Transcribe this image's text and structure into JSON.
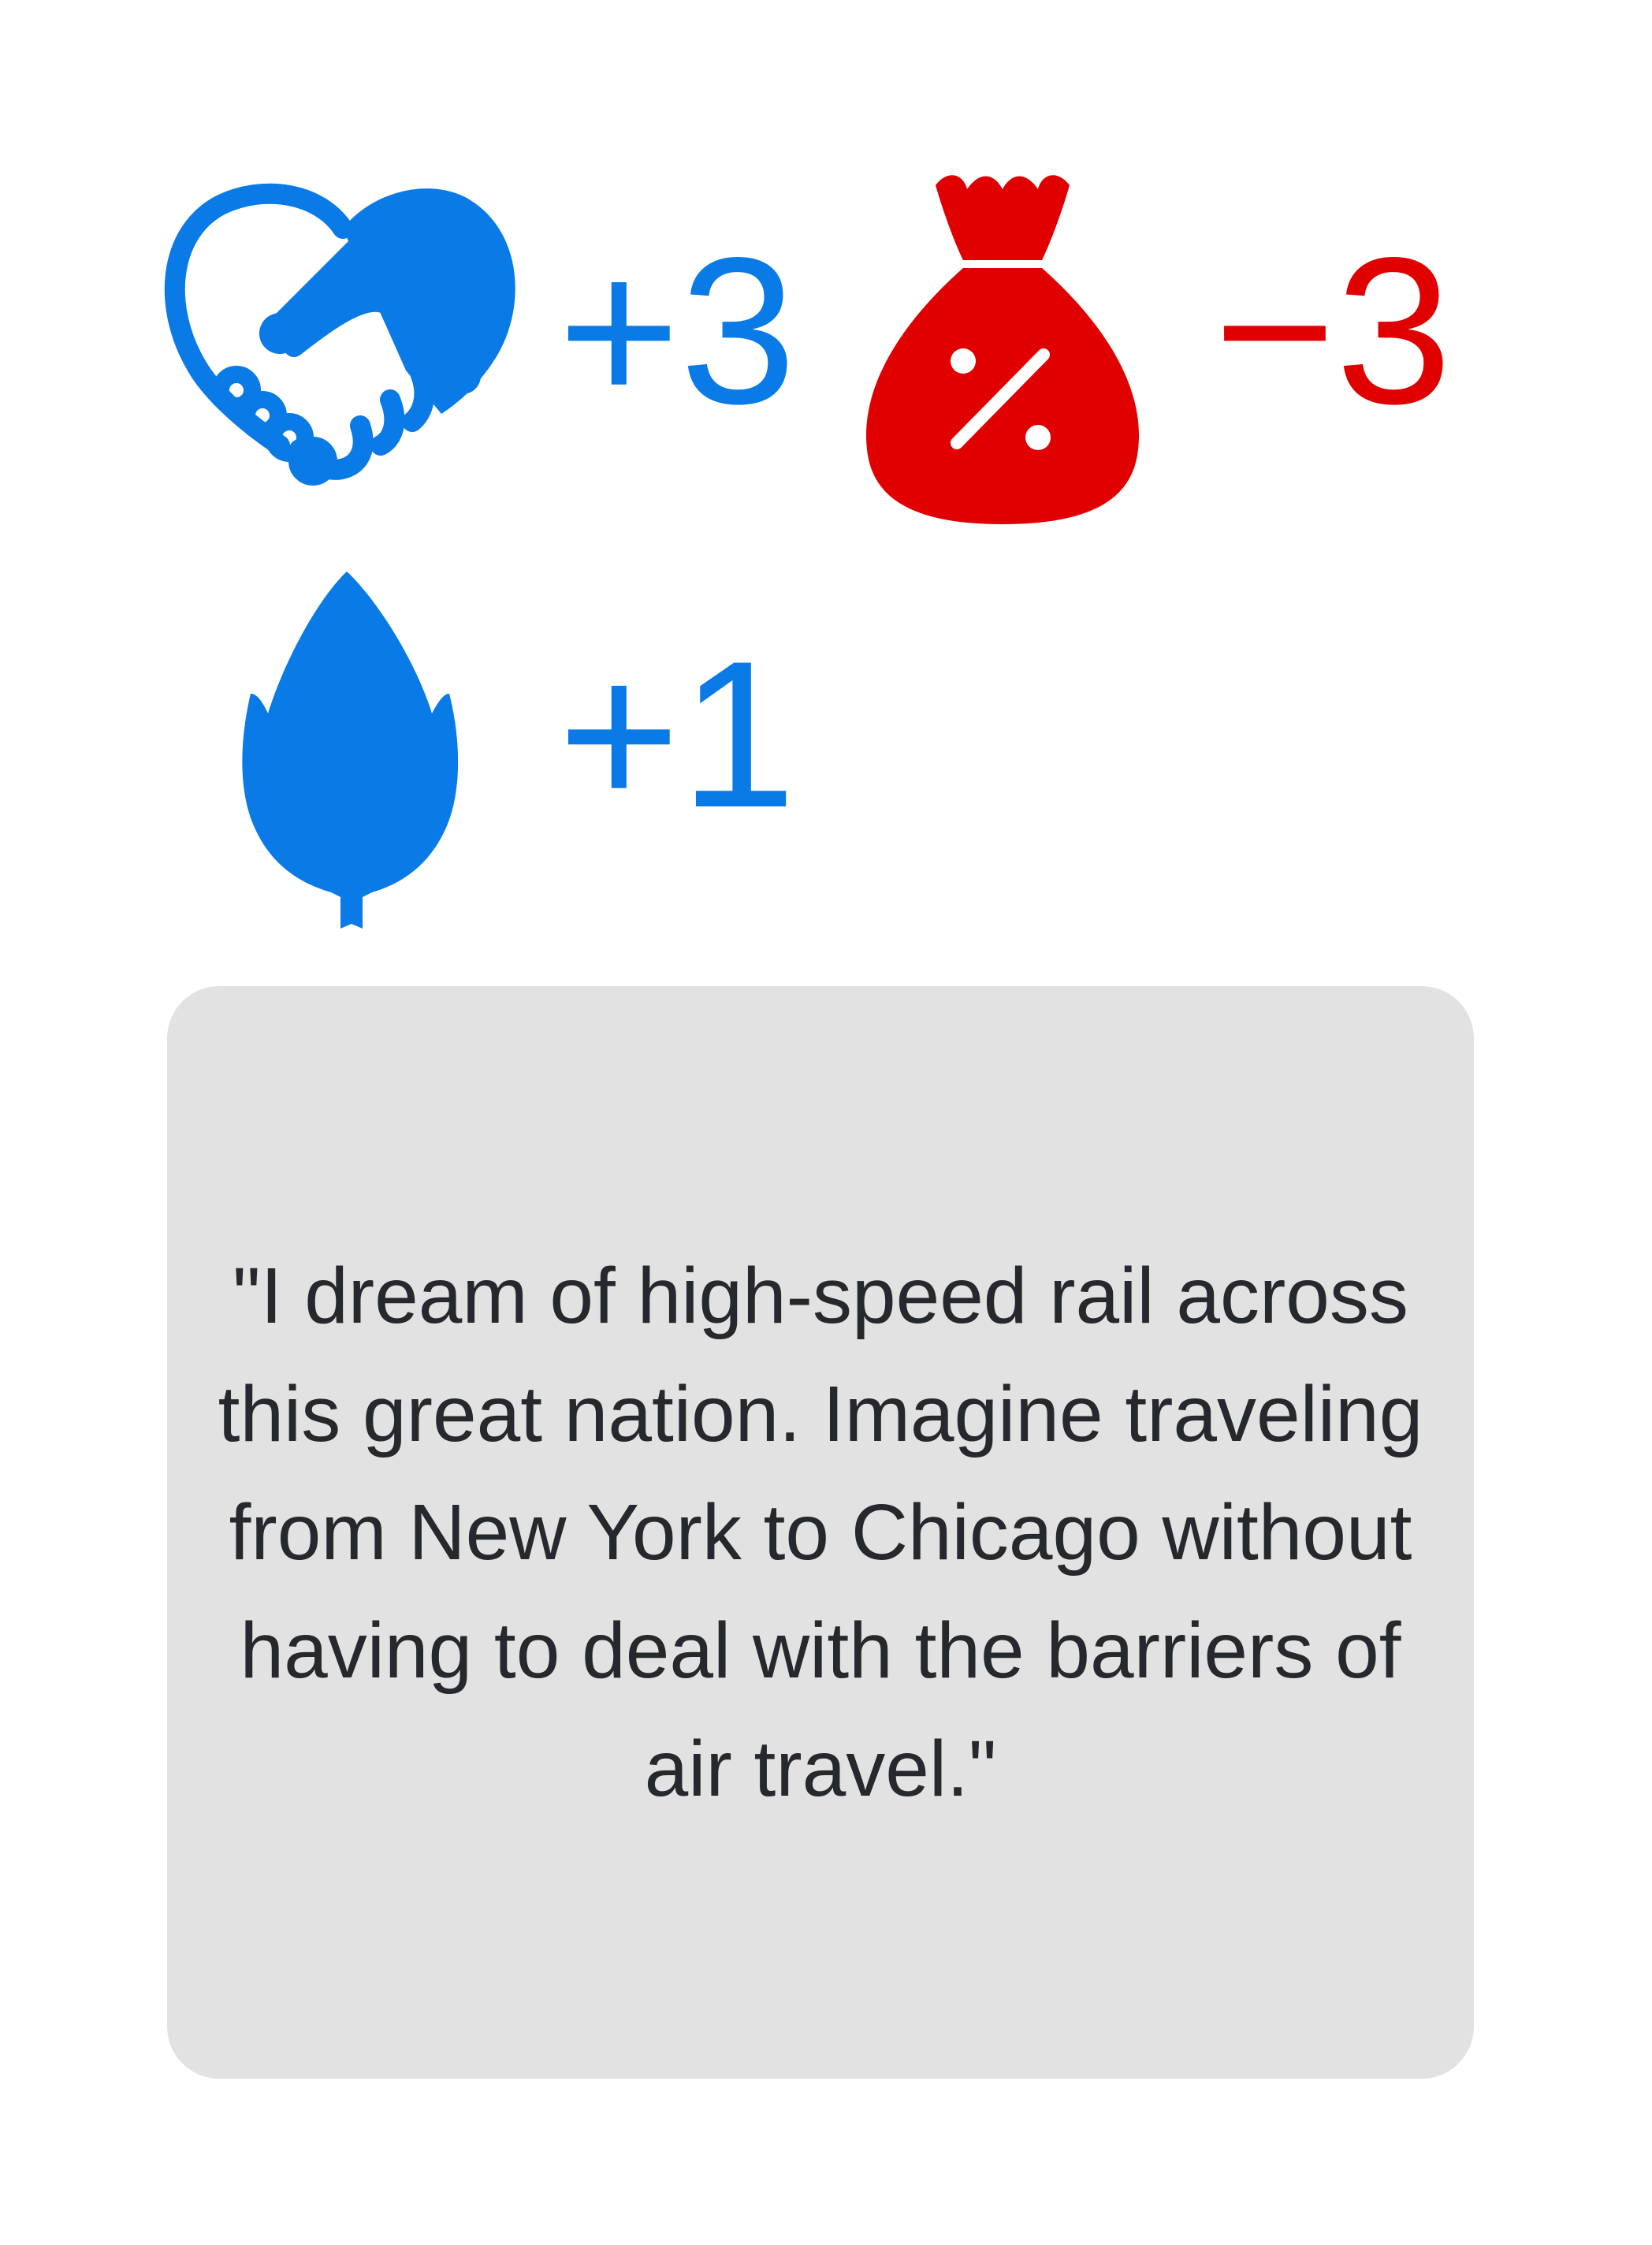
{
  "stats": [
    {
      "icon": "handshake-heart-icon",
      "value": "+3",
      "color": "#0a7ae6"
    },
    {
      "icon": "money-bag-percent-icon",
      "value": "−3",
      "color": "#e00000"
    },
    {
      "icon": "leaf-icon",
      "value": "+1",
      "color": "#0a7ae6"
    }
  ],
  "quote": {
    "text": "\"I dream of high-speed rail across this great nation. Imagine traveling from New York to Chicago without having to deal with the barriers of air travel.\""
  },
  "colors": {
    "positive": "#0a7ae6",
    "negative": "#e00000",
    "card_background": "#e2e2e2",
    "quote_text": "#25282c"
  }
}
